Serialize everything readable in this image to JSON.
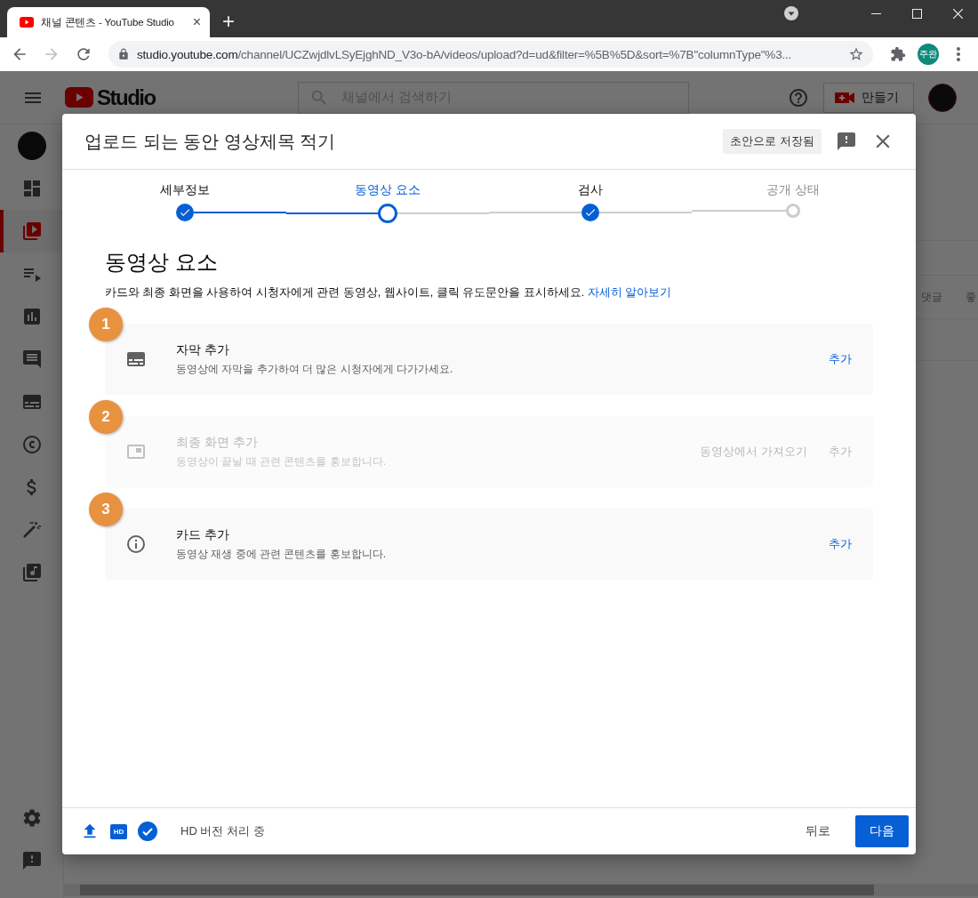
{
  "browser": {
    "tab": {
      "title": "채널 콘텐츠 - YouTube Studio",
      "close": "×"
    },
    "new_tab": "+",
    "nav": {
      "forward_disabled": true
    },
    "url": {
      "host": "studio.youtube.com",
      "path": "/channel/UCZwjdlvLSyEjghND_V3o-bA/videos/upload?d=ud&filter=%5B%5D&sort=%7B\"columnType\"%3..."
    },
    "profile": "주완"
  },
  "studio": {
    "logo": "Studio",
    "search": {
      "placeholder": "채널에서 검색하기"
    },
    "create_button": "만들기",
    "sidebar": [
      {
        "kind": "avatar",
        "selected": false
      },
      {
        "kind": "dashboard",
        "selected": false
      },
      {
        "kind": "content",
        "selected": true
      },
      {
        "kind": "playlists",
        "selected": false
      },
      {
        "kind": "analytics",
        "selected": false
      },
      {
        "kind": "comments",
        "selected": false
      },
      {
        "kind": "subtitles",
        "selected": false
      },
      {
        "kind": "copyright",
        "selected": false
      },
      {
        "kind": "monetization",
        "selected": false
      },
      {
        "kind": "customization",
        "selected": false
      },
      {
        "kind": "audio",
        "selected": false
      }
    ],
    "sidebar_bottom": [
      {
        "kind": "settings"
      },
      {
        "kind": "feedback"
      }
    ],
    "table_columns": [
      "댓글",
      "좋"
    ]
  },
  "dialog": {
    "title": "업로드 되는 동안 영상제목 적기",
    "draft_badge": "초안으로 저장됨",
    "steps": [
      {
        "label": "세부정보",
        "completed": true,
        "selected": false
      },
      {
        "label": "동영상 요소",
        "completed": false,
        "selected": true
      },
      {
        "label": "검사",
        "completed": true,
        "selected": false
      },
      {
        "label": "공개 상태",
        "completed": false,
        "selected": false
      }
    ],
    "heading": "동영상 요소",
    "description": "카드와 최종 화면을 사용하여 시청자에게 관련 동영상, 웹사이트, 클릭 유도문안을 표시하세요.",
    "learn_more": "자세히 알아보기",
    "items": [
      {
        "badge": "1",
        "kind": "subtitles",
        "title": "자막 추가",
        "subtitle": "동영상에 자막을 추가하여 더 많은 시청자에게 다가가세요.",
        "actions": [
          "추가"
        ],
        "disabled": false
      },
      {
        "badge": "2",
        "kind": "end_screen",
        "title": "최종 화면 추가",
        "subtitle": "동영상이 끝날 때 관련 콘텐츠를 홍보합니다.",
        "actions": [
          "동영상에서 가져오기",
          "추가"
        ],
        "disabled": true
      },
      {
        "badge": "3",
        "kind": "cards",
        "title": "카드 추가",
        "subtitle": "동영상 재생 중에 관련 콘텐츠를 홍보합니다.",
        "actions": [
          "추가"
        ],
        "disabled": false
      }
    ],
    "footer": {
      "hd_icon": "HD",
      "status": "HD 버전 처리 중",
      "back": "뒤로",
      "next": "다음"
    }
  }
}
